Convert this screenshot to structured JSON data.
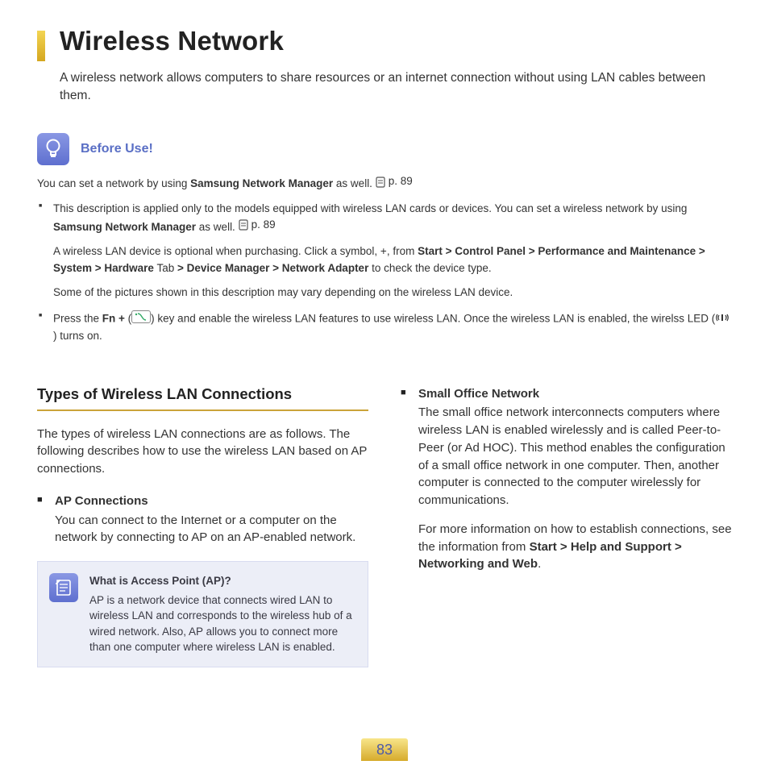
{
  "header": {
    "title": "Wireless Network",
    "intro": "A wireless network allows computers to share resources or an internet connection without using LAN cables between them."
  },
  "beforeUse": {
    "label": "Before Use!",
    "line1_a": "You can set a network by using ",
    "line1_b": "Samsung Network Manager",
    "line1_c": " as well. ",
    "pageRef": "p. 89",
    "bullets": [
      {
        "part_a": "This description is applied only to the models equipped with wireless LAN cards or devices. You can set a wireless network by using ",
        "part_b": "Samsung Network Manager",
        "part_c": " as well. ",
        "pageRef": "p. 89",
        "sub1_a": "A wireless LAN device is optional when purchasing. Click a symbol, +, from ",
        "sub1_b": "Start > Control Panel > Performance and Maintenance > System > Hardware",
        "sub1_b2": " Tab ",
        "sub1_c": "> Device Manager > Network Adapter",
        "sub1_d": " to check the device type.",
        "sub2": "Some of the pictures shown in this description may vary depending on the wireless LAN device."
      },
      {
        "part_a": "Press the ",
        "part_b": "Fn + ",
        "part_c": "(",
        "part_d": ")",
        "part_e": " key and enable the wireless LAN features to use wireless LAN. Once the wireless LAN is enabled, the wirelss LED (",
        "part_f": ") turns on."
      }
    ]
  },
  "leftCol": {
    "heading": "Types of Wireless LAN Connections",
    "intro": "The types of wireless LAN connections are as follows. The following describes how to use the wireless LAN based on AP connections.",
    "ap": {
      "title": "AP Connections",
      "text": "You can connect to the Internet or a computer on the network by connecting to AP on an AP-enabled network."
    },
    "note": {
      "title": "What is Access Point (AP)?",
      "body": "AP is a network device that connects wired LAN to wireless LAN and corresponds to the wireless hub of a wired network. Also, AP allows you to connect more than one computer where wireless LAN is enabled."
    }
  },
  "rightCol": {
    "small": {
      "title": "Small Office Network",
      "text": "The small office network interconnects computers where wireless LAN is enabled wirelessly and is called Peer-to-Peer (or Ad HOC). This method enables the configuration of a small office network in one computer. Then, another computer is connected to the computer wirelessly for communications."
    },
    "more_a": "For more information on how to establish connections, see the information from ",
    "more_b": "Start > Help and Support > Networking and Web",
    "more_c": "."
  },
  "pageNumber": "83"
}
